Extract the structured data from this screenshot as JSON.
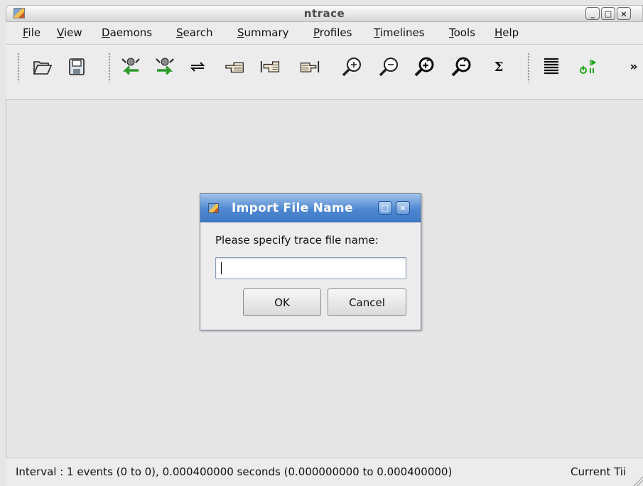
{
  "window": {
    "title": "ntrace",
    "buttons": [
      "_",
      "□",
      "×"
    ]
  },
  "menubar": {
    "items": [
      {
        "label": "File"
      },
      {
        "label": "View"
      },
      {
        "label": "Daemons"
      },
      {
        "label": "Search"
      },
      {
        "label": "Summary"
      },
      {
        "label": "Profiles"
      },
      {
        "label": "Timelines"
      },
      {
        "label": "Tools"
      },
      {
        "label": "Help"
      }
    ]
  },
  "toolbar": {
    "icons": [
      "open-folder-icon",
      "save-floppy-icon",
      "daemon-left-icon",
      "daemon-right-icon",
      "swap-arrows-icon",
      "hand-point-left-icon",
      "hand-point-both-icon",
      "hand-point-right-icon",
      "zoom-in-icon",
      "zoom-out-icon",
      "zoom-in-fast-icon",
      "zoom-out-fast-icon",
      "sigma-icon",
      "list-icon",
      "power-play-pause-icon"
    ],
    "sigma_glyph": "Σ",
    "overflow_glyph": "»"
  },
  "statusbar": {
    "text": "Interval : 1 events (0 to 0), 0.000400000 seconds (0.000000000 to 0.000400000)",
    "right_text": "Current Tii"
  },
  "dialog": {
    "title": "Import File Name",
    "label": "Please specify trace file name:",
    "input_value": "",
    "ok_label": "OK",
    "cancel_label": "Cancel"
  },
  "colors": {
    "dialog_title": "#4f88d2",
    "background": "#e6e6e6"
  }
}
